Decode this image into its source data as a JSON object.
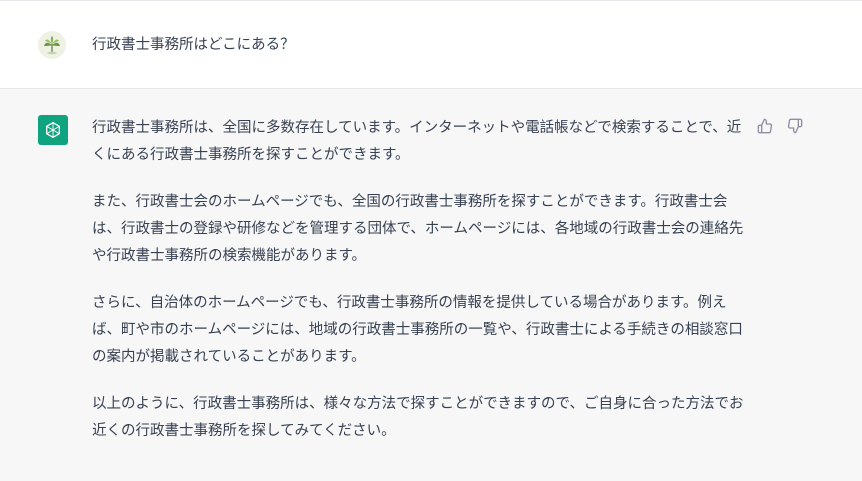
{
  "user_message": {
    "avatar_icon": "user-avatar-plant-icon",
    "text": "行政書士事務所はどこにある？"
  },
  "assistant_message": {
    "avatar_icon": "openai-logo-icon",
    "paragraphs": [
      "行政書士事務所は、全国に多数存在しています。インターネットや電話帳などで検索することで、近くにある行政書士事務所を探すことができます。",
      "また、行政書士会のホームページでも、全国の行政書士事務所を探すことができます。行政書士会は、行政書士の登録や研修などを管理する団体で、ホームページには、各地域の行政書士会の連絡先や行政書士事務所の検索機能があります。",
      "さらに、自治体のホームページでも、行政書士事務所の情報を提供している場合があります。例えば、町や市のホームページには、地域の行政書士事務所の一覧や、行政書士による手続きの相談窓口の案内が掲載されていることがあります。",
      "以上のように、行政書士事務所は、様々な方法で探すことができますので、ご自身に合った方法でお近くの行政書士事務所を探してみてください。"
    ],
    "feedback": {
      "thumbs_up_icon": "thumbs-up-icon",
      "thumbs_down_icon": "thumbs-down-icon"
    }
  },
  "colors": {
    "assistant_bg": "#f7f7f8",
    "brand_green": "#10a37f",
    "text": "#374151"
  }
}
